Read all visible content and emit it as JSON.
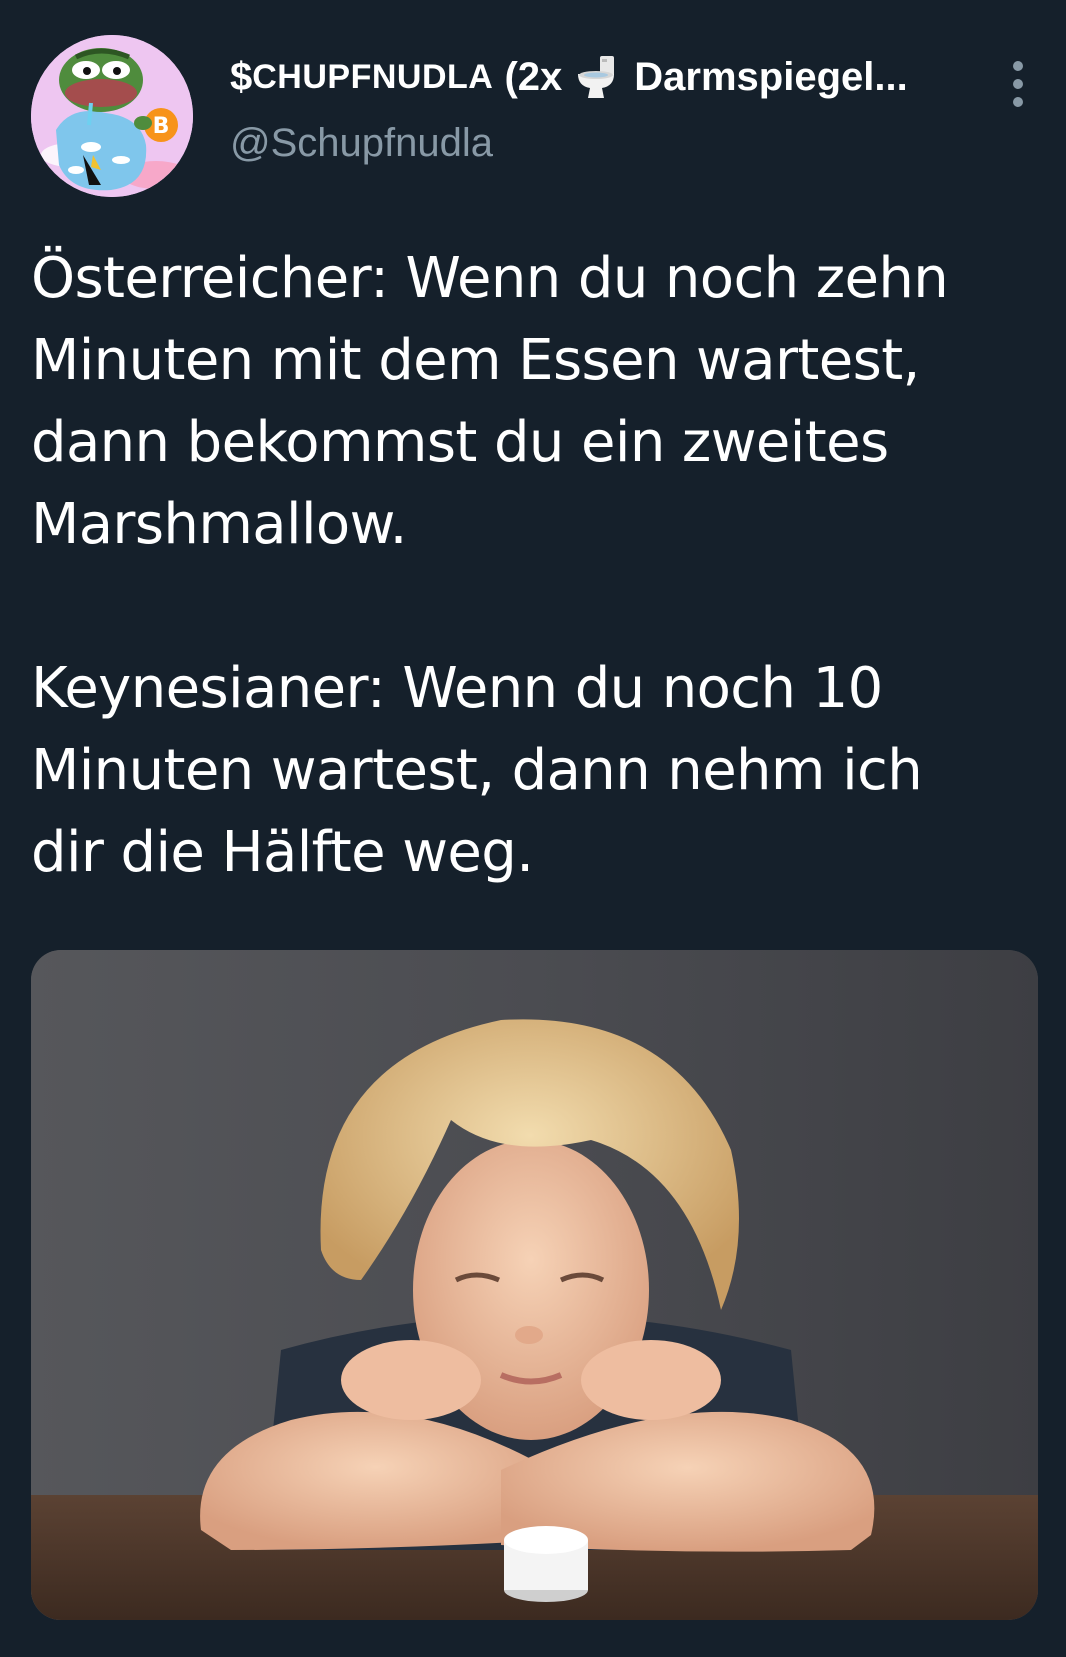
{
  "user": {
    "display_name_prefix": "$",
    "display_name_smallcaps": "CHUPFNUDLA",
    "display_name_mid": "(2x",
    "display_name_suffix": "Darmspiegel...",
    "handle": "@Schupfnudla",
    "avatar_icon": "pepe-bitcoin-avatar",
    "toilet_icon": "toilet-emoji"
  },
  "tweet": {
    "paragraph_1": [
      "Österreicher: Wenn du noch zehn",
      "Minuten mit dem Essen wartest,",
      "dann bekommst du ein zweites",
      "Marshmallow."
    ],
    "paragraph_2": [
      "Keynesianer: Wenn du noch 10",
      "Minuten wartest, dann nehm ich",
      "dir die Hälfte weg."
    ]
  },
  "media": {
    "image_icon": "child-marshmallow-photo"
  },
  "colors": {
    "background": "#15202b",
    "text": "#ffffff",
    "secondary_text": "#8899a6"
  }
}
